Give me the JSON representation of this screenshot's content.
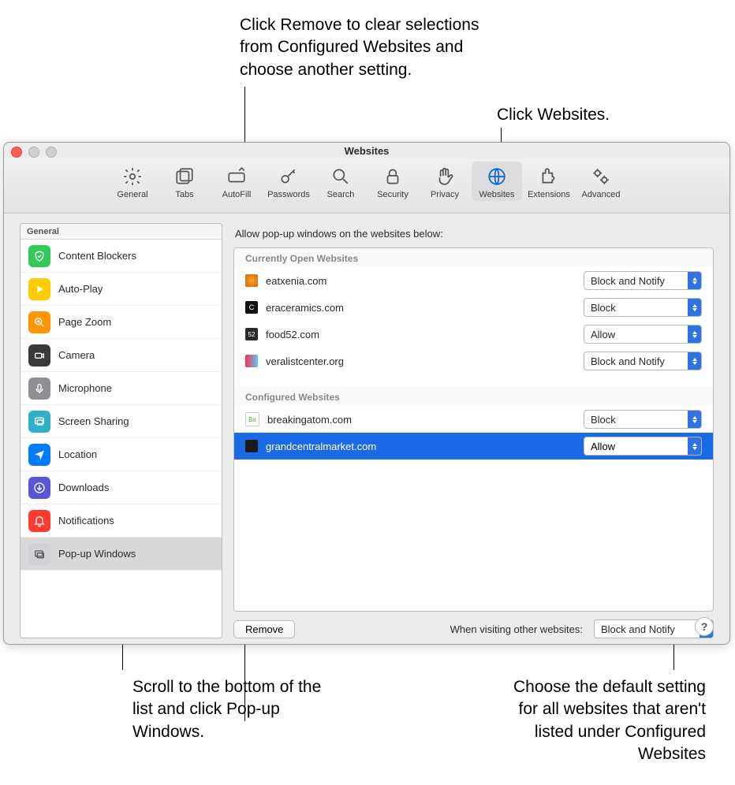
{
  "window": {
    "title": "Websites"
  },
  "toolbar": {
    "items": [
      {
        "label": "General"
      },
      {
        "label": "Tabs"
      },
      {
        "label": "AutoFill"
      },
      {
        "label": "Passwords"
      },
      {
        "label": "Search"
      },
      {
        "label": "Security"
      },
      {
        "label": "Privacy"
      },
      {
        "label": "Websites"
      },
      {
        "label": "Extensions"
      },
      {
        "label": "Advanced"
      }
    ],
    "selected_index": 7
  },
  "sidebar": {
    "header": "General",
    "items": [
      {
        "label": "Content Blockers",
        "icon": "shield-icon",
        "color": "#34c759"
      },
      {
        "label": "Auto-Play",
        "icon": "play-icon",
        "color": "#ffcc00"
      },
      {
        "label": "Page Zoom",
        "icon": "zoom-icon",
        "color": "#ff9500"
      },
      {
        "label": "Camera",
        "icon": "camera-icon",
        "color": "#3a3a3a"
      },
      {
        "label": "Microphone",
        "icon": "mic-icon",
        "color": "#8e8e93"
      },
      {
        "label": "Screen Sharing",
        "icon": "screen-icon",
        "color": "#30b0c7"
      },
      {
        "label": "Location",
        "icon": "location-icon",
        "color": "#007aff"
      },
      {
        "label": "Downloads",
        "icon": "download-icon",
        "color": "#5856d6"
      },
      {
        "label": "Notifications",
        "icon": "bell-icon",
        "color": "#ff3b30"
      },
      {
        "label": "Pop-up Windows",
        "icon": "popup-icon",
        "color": "#d1d1d6"
      }
    ],
    "selected_index": 9
  },
  "panel": {
    "description": "Allow pop-up windows on the websites below:",
    "sections": {
      "open": {
        "header": "Currently Open Websites",
        "rows": [
          {
            "site": "eatxenia.com",
            "value": "Block and Notify",
            "fav": "#f7a12b"
          },
          {
            "site": "eraceramics.com",
            "value": "Block",
            "fav": "#111111"
          },
          {
            "site": "food52.com",
            "value": "Allow",
            "fav": "#2b2b2b"
          },
          {
            "site": "veralistcenter.org",
            "value": "Block and Notify",
            "fav": "linear-gradient(90deg,#ff2d55,#5ac8fa)"
          }
        ]
      },
      "configured": {
        "header": "Configured Websites",
        "rows": [
          {
            "site": "breakingatom.com",
            "value": "Block",
            "fav": "#ffffff",
            "selected": false
          },
          {
            "site": "grandcentralmarket.com",
            "value": "Allow",
            "fav": "#1a1a1a",
            "selected": true
          }
        ]
      }
    },
    "remove_label": "Remove",
    "other_label": "When visiting other websites:",
    "other_value": "Block and Notify"
  },
  "callouts": {
    "top_left": "Click Remove to clear selections from Configured Websites and choose another setting.",
    "top_right": "Click Websites.",
    "bottom_left": "Scroll to the bottom of the list and click Pop-up Windows.",
    "bottom_right": "Choose the default setting for all websites that aren't listed under Configured Websites"
  },
  "help_glyph": "?"
}
